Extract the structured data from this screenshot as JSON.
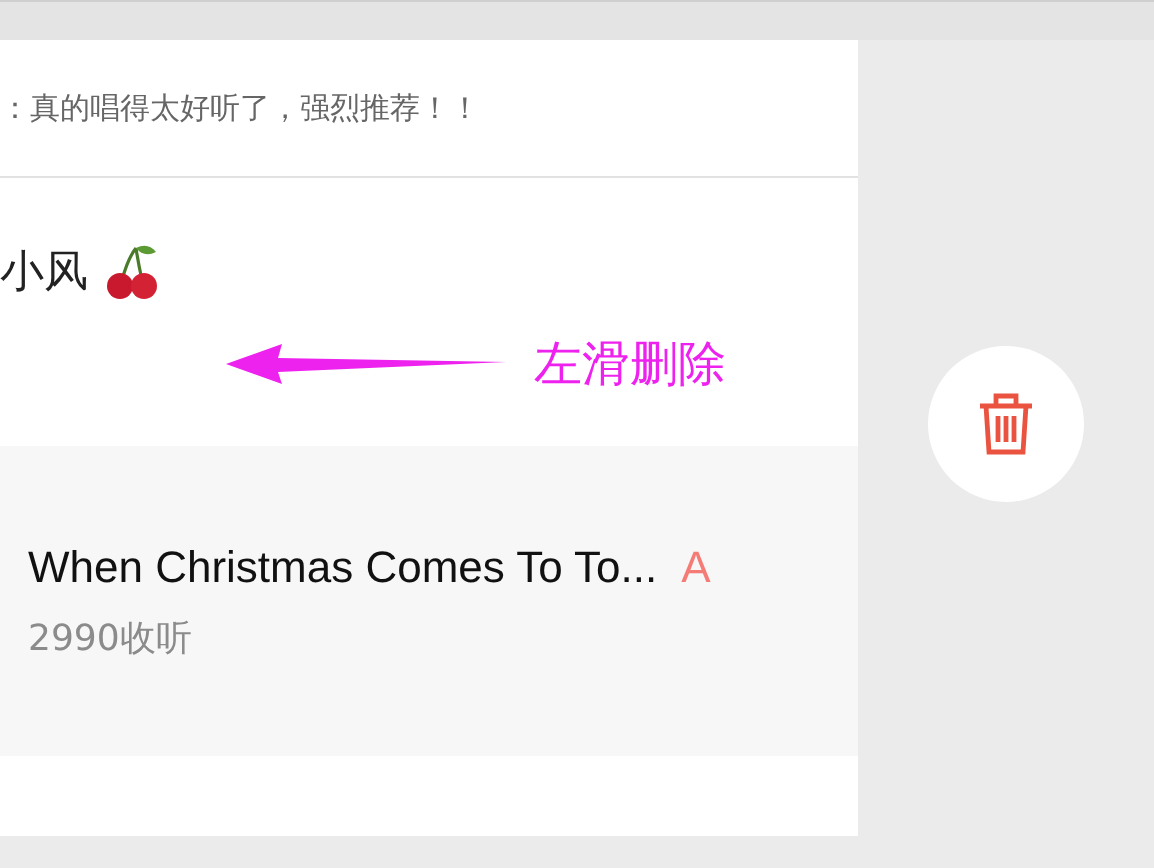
{
  "comment": {
    "text": "：真的唱得太好听了，强烈推荐！！"
  },
  "user": {
    "name": "小风"
  },
  "annotation": {
    "text": "左滑删除"
  },
  "song": {
    "title": "When Christmas Comes To To...",
    "badge": "A",
    "listens": "2990收听"
  },
  "delete_action": {
    "kind": "trash"
  }
}
